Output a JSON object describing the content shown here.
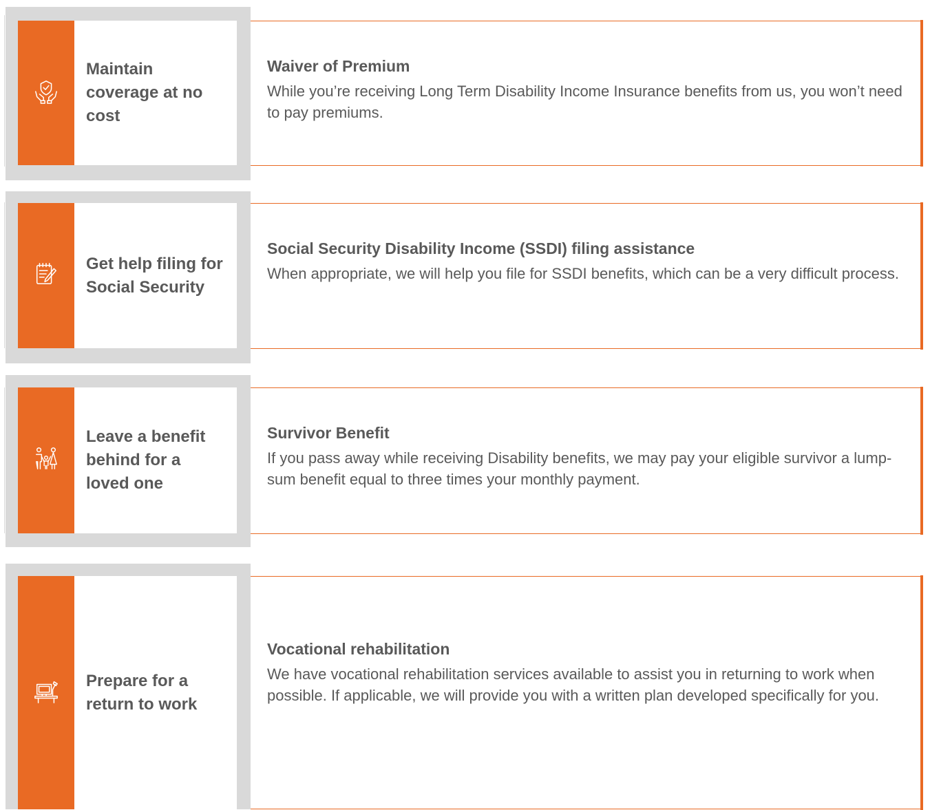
{
  "accent_color": "#e96a24",
  "frame_color": "#d9d9d9",
  "text_color": "#595959",
  "benefits": [
    {
      "icon": "hands-shield-icon",
      "label": "Maintain coverage at no cost",
      "title": "Waiver of Premium",
      "description": "While you’re receiving Long Term Disability Income Insurance benefits from us, you won’t need to pay premiums."
    },
    {
      "icon": "notepad-pencil-icon",
      "label": "Get help filing for Social Security",
      "title": "Social Security Disability Income (SSDI) filing assistance",
      "description": "When appropriate, we will help you file for SSDI benefits, which can be a very difficult process."
    },
    {
      "icon": "family-icon",
      "label": "Leave a benefit behind for a loved one",
      "title": "Survivor Benefit",
      "description": "If you pass away while receiving Disability benefits, we may pay your eligible survivor a lump-sum benefit equal to three times your monthly payment."
    },
    {
      "icon": "desk-computer-icon",
      "label": "Prepare for a return to work",
      "title": "Vocational rehabilitation",
      "description": "We have vocational rehabilitation services available to assist you in returning to work when possible. If applicable, we will provide you with a written plan developed specifically for you."
    }
  ]
}
